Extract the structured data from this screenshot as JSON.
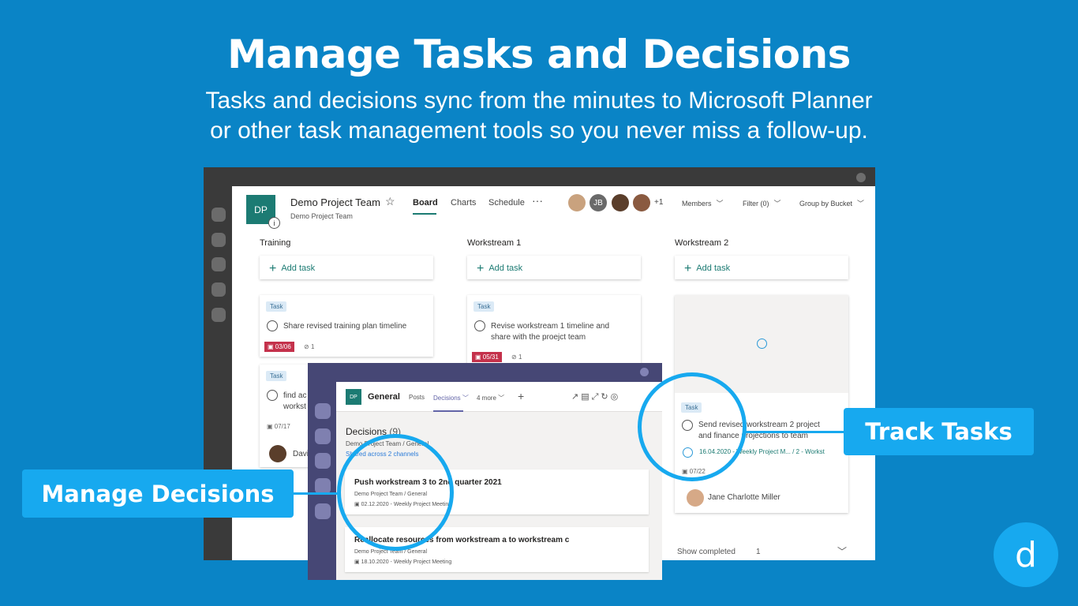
{
  "headline": "Manage Tasks and Decisions",
  "subline": [
    "Tasks and decisions sync from the minutes to Microsoft Planner",
    "or other task management tools so you never miss a follow-up."
  ],
  "planner": {
    "avatar": "DP",
    "team_name": "Demo Project Team",
    "team_sub": "Demo Project Team",
    "tabs": [
      "Board",
      "Charts",
      "Schedule"
    ],
    "more": "···",
    "member_initials": "JB",
    "member_more": "+1",
    "members_label": "Members",
    "filter_label": "Filter (0)",
    "group_label": "Group by Bucket",
    "add_task_label": "Add task",
    "columns": [
      {
        "title": "Training",
        "cards": [
          {
            "badge": "Task",
            "text": "Share revised training plan timeline",
            "date": "03/06",
            "attachments": "1"
          },
          {
            "badge": "Task",
            "text": "find ac",
            "text2": "workst",
            "date": "07/17",
            "assignee": "David"
          }
        ]
      },
      {
        "title": "Workstream 1",
        "cards": [
          {
            "badge": "Task",
            "text": "Revise workstream 1 timeline and",
            "text2": "share with the proejct team",
            "date": "05/31",
            "attachments": "1"
          }
        ]
      },
      {
        "title": "Workstream 2",
        "cards": [
          {
            "badge": "Task",
            "text": "Send revised workstream 2 project",
            "text2": "and finance projections to team",
            "link": "16.04.2020 - Weekly Project M... / 2 - Workst",
            "date": "07/22",
            "assignee": "Jane Charlotte Miller"
          }
        ]
      }
    ],
    "show_completed_label": "Show completed",
    "show_completed_count": "1"
  },
  "decisions_window": {
    "avatar": "DP",
    "channel": "General",
    "tabs": [
      "Posts",
      "Decisions",
      "4 more"
    ],
    "add": "+",
    "title": "Decisions",
    "count": "(9)",
    "sub": "Demo Project Team / General",
    "shared": "Shared across 2 channels",
    "items": [
      {
        "title": "Push workstream 3 to 2nd quarter 2021",
        "path": "Demo Project Team / General",
        "meta": "02.12.2020 - Weekly Project Meeting"
      },
      {
        "title": "Reallocate resources from workstream a to workstream c",
        "path": "Demo Project Team / General",
        "meta": "18.10.2020 - Weekly Project Meeting"
      }
    ]
  },
  "callouts": {
    "left": "Manage Decisions",
    "right": "Track Tasks"
  },
  "brand_letter": "d",
  "colors": {
    "background": "#0a84c6",
    "accent": "#17a9ef",
    "teams_purple": "#464775",
    "planner_green": "#1c7b73"
  }
}
